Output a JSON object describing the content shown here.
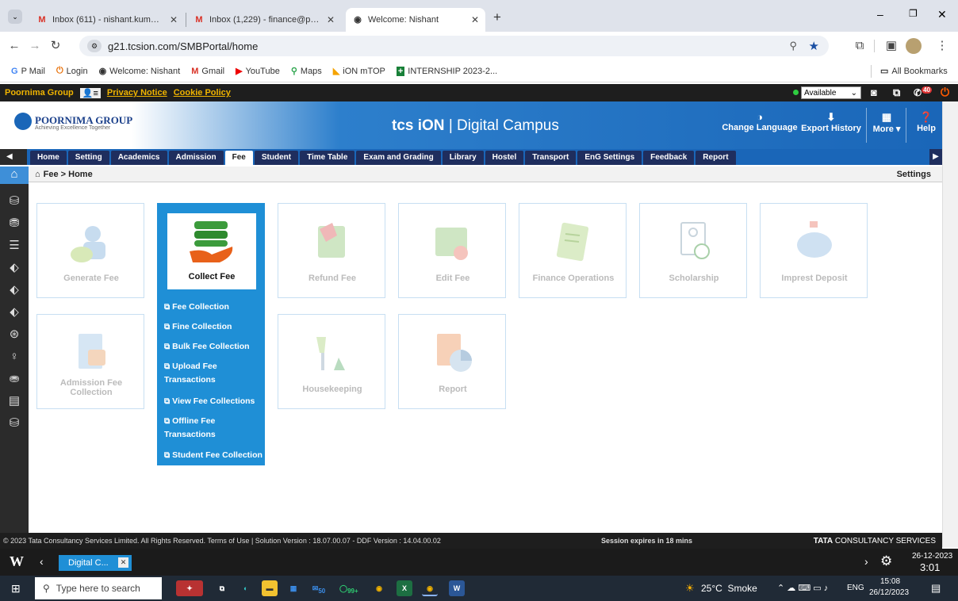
{
  "browser": {
    "tabs": [
      {
        "title": "Inbox (611) - nishant.kumar@p",
        "favicon": "gmail"
      },
      {
        "title": "Inbox (1,229) - finance@poorni",
        "favicon": "gmail"
      },
      {
        "title": "Welcome: Nishant",
        "favicon": "globe"
      }
    ],
    "new_tab": "+",
    "url": "g21.tcsion.com/SMBPortal/home",
    "bookmarks": [
      "P Mail",
      "Login",
      "Welcome: Nishant",
      "Gmail",
      "YouTube",
      "Maps",
      "iON mTOP",
      "INTERNSHIP 2023-2..."
    ],
    "all_bookmarks": "All Bookmarks"
  },
  "portal_bar": {
    "org": "Poornima Group",
    "privacy": "Privacy Notice",
    "cookie": "Cookie Policy",
    "status": "Available",
    "badge": "40"
  },
  "header": {
    "logo_name": "POORNIMA GROUP",
    "logo_tag": "Achieving Excellence Together",
    "title": "TCS iON | Digital Campus",
    "title_brand": "tcs iON",
    "title_rest": "| Digital Campus",
    "actions": [
      {
        "label": "Change Language",
        "icon": "language-icon"
      },
      {
        "label": "Export History",
        "icon": "download-icon"
      },
      {
        "label": "More ▾",
        "icon": "grid-icon"
      },
      {
        "label": "Help",
        "icon": "help-icon"
      }
    ]
  },
  "menu": [
    "Home",
    "Setting",
    "Academics",
    "Admission",
    "Fee",
    "Student",
    "Time Table",
    "Exam and Grading",
    "Library",
    "Hostel",
    "Transport",
    "EnG Settings",
    "Feedback",
    "Report"
  ],
  "active_menu": "Fee",
  "breadcrumb": "Fee > Home",
  "settings_label": "Settings",
  "tiles": [
    {
      "label": "Generate Fee"
    },
    {
      "label": "Collect Fee"
    },
    {
      "label": "Refund Fee"
    },
    {
      "label": "Edit Fee"
    },
    {
      "label": "Finance Operations"
    },
    {
      "label": "Scholarship"
    },
    {
      "label": "Imprest Deposit"
    },
    {
      "label": "Admission Fee Collection"
    },
    {
      "label": "Housekeeping"
    },
    {
      "label": "Report"
    }
  ],
  "collect_submenu": [
    "Fee Collection",
    "Fine Collection",
    "Bulk Fee Collection",
    "Upload Fee Transactions",
    "View Fee Collections",
    "Offline Fee Transactions",
    "Student Fee Collection"
  ],
  "footer": {
    "copyright": "© 2023 Tata Consultancy Services Limited. All Rights Reserved.   Terms of Use | Solution Version : 18.07.00.07 - DDF Version : 14.04.00.02",
    "session": "Session expires in 18 mins",
    "brand_bold": "TATA",
    "brand_rest": "CONSULTANCY SERVICES"
  },
  "remote_bar": {
    "tab": "Digital C...",
    "date": "26-12-2023",
    "time": "3:01 PM"
  },
  "taskbar": {
    "search_placeholder": "Type here to search",
    "badge1": "50",
    "badge2": "99+",
    "weather": "25°C  Smoke",
    "lang": "ENG",
    "time": "15:08",
    "date": "26/12/2023"
  }
}
